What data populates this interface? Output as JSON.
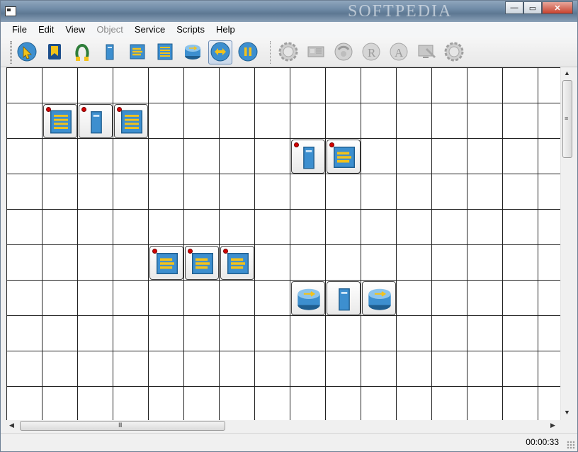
{
  "window": {
    "watermark": "SOFTPEDIA",
    "controls": {
      "minimize": "—",
      "maximize": "▭",
      "close": "✕"
    }
  },
  "menu": [
    {
      "label": "File",
      "enabled": true
    },
    {
      "label": "Edit",
      "enabled": true
    },
    {
      "label": "View",
      "enabled": true
    },
    {
      "label": "Object",
      "enabled": false
    },
    {
      "label": "Service",
      "enabled": true
    },
    {
      "label": "Scripts",
      "enabled": true
    },
    {
      "label": "Help",
      "enabled": true
    }
  ],
  "toolbar": {
    "primary": [
      {
        "icon": "pointer-icon",
        "enabled": true,
        "active": false
      },
      {
        "icon": "bookmark-icon",
        "enabled": true,
        "active": false
      },
      {
        "icon": "cable-icon",
        "enabled": true,
        "active": false
      },
      {
        "icon": "server-icon",
        "enabled": true,
        "active": false
      },
      {
        "icon": "switch-icon",
        "enabled": true,
        "active": false
      },
      {
        "icon": "hub-icon",
        "enabled": true,
        "active": false
      },
      {
        "icon": "router-icon",
        "enabled": true,
        "active": false
      },
      {
        "icon": "simulate-icon",
        "enabled": true,
        "active": true
      },
      {
        "icon": "pause-icon",
        "enabled": true,
        "active": false
      }
    ],
    "secondary": [
      {
        "icon": "settings-gear-icon",
        "enabled": false
      },
      {
        "icon": "network-card-icon",
        "enabled": false
      },
      {
        "icon": "phone-icon",
        "enabled": false
      },
      {
        "icon": "route-r-icon",
        "enabled": false
      },
      {
        "icon": "arp-a-icon",
        "enabled": false
      },
      {
        "icon": "monitor-tools-icon",
        "enabled": false
      },
      {
        "icon": "properties-gear-icon",
        "enabled": false
      }
    ]
  },
  "grid": {
    "rows": 9,
    "cols": 16
  },
  "nodes": [
    {
      "type": "hub",
      "row": 1,
      "col": 1,
      "led": true
    },
    {
      "type": "computer",
      "row": 1,
      "col": 2,
      "led": true
    },
    {
      "type": "hub",
      "row": 1,
      "col": 3,
      "led": true
    },
    {
      "type": "computer",
      "row": 2,
      "col": 8,
      "led": true
    },
    {
      "type": "switch",
      "row": 2,
      "col": 9,
      "led": true
    },
    {
      "type": "switch",
      "row": 5,
      "col": 4,
      "led": true
    },
    {
      "type": "switch",
      "row": 5,
      "col": 5,
      "led": true
    },
    {
      "type": "switch",
      "row": 5,
      "col": 6,
      "led": true
    },
    {
      "type": "router",
      "row": 6,
      "col": 8,
      "led": false
    },
    {
      "type": "computer",
      "row": 6,
      "col": 9,
      "led": false
    },
    {
      "type": "router",
      "row": 6,
      "col": 10,
      "led": false
    }
  ],
  "status": {
    "time": "00:00:33"
  },
  "scrollbars": {
    "hgrip": "III",
    "vgrip": "≡"
  }
}
